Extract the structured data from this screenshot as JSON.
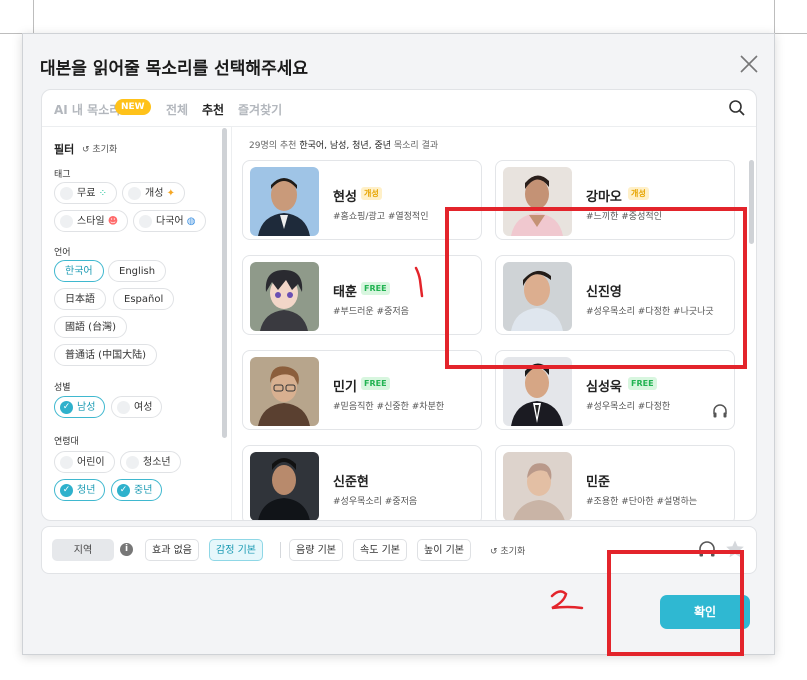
{
  "modal": {
    "title": "대본을 읽어줄 목소리를 선택해주세요",
    "confirm_label": "확인"
  },
  "tabs": {
    "my_voice": "AI 내 목소리",
    "new_badge": "NEW",
    "all": "전체",
    "recommended": "추천",
    "favorites": "즐겨찾기"
  },
  "filter": {
    "title": "필터",
    "reset": "초기화",
    "tag_label": "태그",
    "tags": [
      "무료",
      "개성",
      "스타일",
      "다국어"
    ],
    "language_label": "언어",
    "languages": [
      "한국어",
      "English",
      "日本語",
      "Español",
      "國語 (台灣)",
      "普通话 (中国大陆)"
    ],
    "gender_label": "성별",
    "genders": [
      "남성",
      "여성"
    ],
    "age_label": "연령대",
    "ages": [
      "어린이",
      "청소년",
      "청년",
      "중년"
    ]
  },
  "results": {
    "count_prefix": "29명의 추천",
    "criteria": "한국어, 남성, 청년, 중년",
    "suffix": "목소리 결과",
    "voices": [
      {
        "name": "현성",
        "badge": "개성",
        "tags": "#홈쇼핑/광고 #열정적인"
      },
      {
        "name": "강마오",
        "badge": "개성",
        "tags": "#느끼한 #중성적인"
      },
      {
        "name": "태훈",
        "badge": "FREE",
        "tags": "#부드러운 #중저음"
      },
      {
        "name": "신진영",
        "badge": "",
        "tags": "#성우목소리 #다정한 #나긋나긋"
      },
      {
        "name": "민기",
        "badge": "FREE",
        "tags": "#믿음직한 #신중한 #차분한"
      },
      {
        "name": "심성욱",
        "badge": "FREE",
        "tags": "#성우목소리 #다정한"
      },
      {
        "name": "신준현",
        "badge": "",
        "tags": "#성우목소리 #중저음"
      },
      {
        "name": "민준",
        "badge": "",
        "tags": "#조용한 #단아한 #설명하는"
      }
    ]
  },
  "controls": {
    "dialect": "지역",
    "effect": "효과 없음",
    "emotion": "감정 기본",
    "volume": "음량 기본",
    "speed": "속도 기본",
    "pitch": "높이 기본",
    "reset": "초기화"
  },
  "colors": {
    "accent": "#2fb8d2",
    "annotation_red": "#e3242b",
    "free_badge": "#22b352",
    "new_badge": "#ffc21a"
  }
}
